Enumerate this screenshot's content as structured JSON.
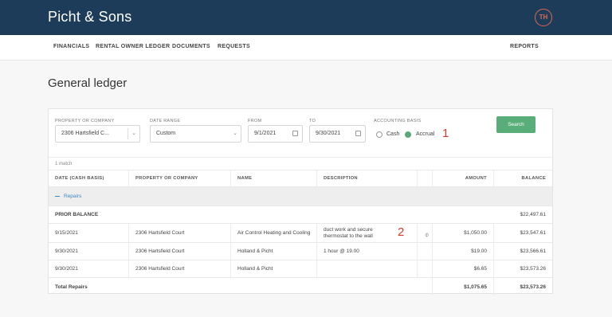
{
  "app": {
    "title": "Picht & Sons",
    "user_initials": "TH"
  },
  "nav": {
    "items": [
      "FINANCIALS",
      "RENTAL OWNER LEDGER",
      "DOCUMENTS",
      "REQUESTS"
    ],
    "reports": "REPORTS"
  },
  "page": {
    "title": "General ledger"
  },
  "filters": {
    "property_label": "PROPERTY OR COMPANY",
    "property_value": "2306 Hartsfield C...",
    "date_range_label": "DATE RANGE",
    "date_range_value": "Custom",
    "from_label": "FROM",
    "from_value": "9/1/2021",
    "to_label": "TO",
    "to_value": "9/30/2021",
    "basis_label": "ACCOUNTING BASIS",
    "basis_options": [
      "Cash",
      "Accrual"
    ],
    "basis_selected": "Accrual",
    "search_label": "Search"
  },
  "annotations": [
    "1",
    "2"
  ],
  "results": {
    "count_text": "1 match"
  },
  "table": {
    "headers": [
      "DATE (CASH BASIS)",
      "PROPERTY OR COMPANY",
      "NAME",
      "DESCRIPTION",
      "",
      "AMOUNT",
      "BALANCE"
    ],
    "group": "Repairs",
    "prior_balance": {
      "label": "PRIOR BALANCE",
      "balance": "$22,497.61"
    },
    "rows": [
      {
        "date": "9/15/2021",
        "property": "2306 Hartsfield Court",
        "name": "Air Control Heating and Cooling",
        "description": "duct work and secure thermostat to the wall",
        "has_attachment": true,
        "amount": "$1,050.00",
        "balance": "$23,547.61"
      },
      {
        "date": "9/30/2021",
        "property": "2306 Hartsfield Court",
        "name": "Holland & Picht",
        "description": "1 hour @ 19.00",
        "has_attachment": false,
        "amount": "$19.00",
        "balance": "$23,566.61"
      },
      {
        "date": "9/30/2021",
        "property": "2306 Hartsfield Court",
        "name": "Holland & Picht",
        "description": "",
        "has_attachment": false,
        "amount": "$6.65",
        "balance": "$23,573.26"
      }
    ],
    "total": {
      "label": "Total Repairs",
      "amount": "$1,075.65",
      "balance": "$23,573.26"
    }
  },
  "colors": {
    "header_bg": "#1d3c5a",
    "accent_green": "#58ad78",
    "link_blue": "#3b88c4",
    "annotation_red": "#d33a2c"
  },
  "icons": {
    "attachment": "paperclip-icon",
    "calendar": "calendar-icon",
    "dropdown": "chevron-down-icon",
    "group_toggle": "minus-icon"
  }
}
